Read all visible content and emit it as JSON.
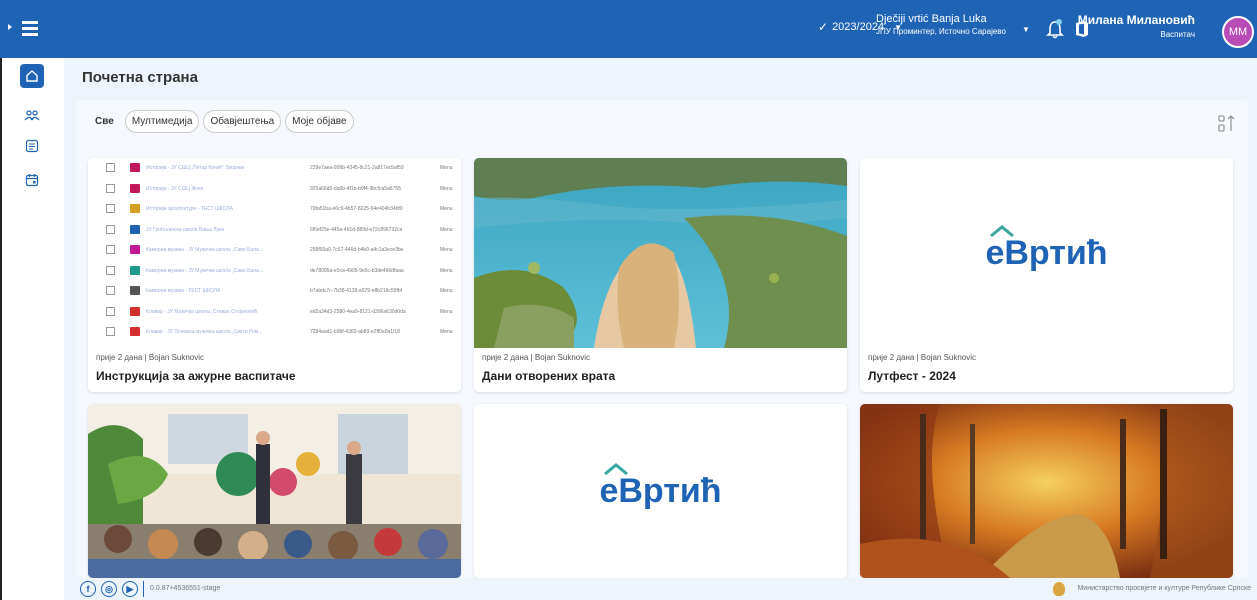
{
  "header": {
    "school_year": "2023/2024",
    "kindergarten_name": "Dječiji vrtić Banja Luka",
    "kindergarten_sub": "ЈПУ Проминтер, Источно Сарајево",
    "user_name": "Милана Милановић",
    "user_role": "Васпитач",
    "avatar_initials": "ММ"
  },
  "sidebar": {
    "items": [
      {
        "icon": "home-icon"
      },
      {
        "icon": "children-icon"
      },
      {
        "icon": "board-icon"
      },
      {
        "icon": "calendar-icon"
      }
    ]
  },
  "page": {
    "title": "Почетна страна"
  },
  "filters": [
    "Све",
    "Мултимедија",
    "Обавјештења",
    "Моје објаве"
  ],
  "posts": [
    {
      "meta": "прије 2 дана | Bojan Suknovic",
      "title": "Инструкција за ажурне васпитаче",
      "media": "spreadsheet"
    },
    {
      "meta": "прије 2 дана | Bojan Suknovic",
      "title": "Дани отворених врата",
      "media": "lake-photo"
    },
    {
      "meta": "прије 2 дана | Bojan Suknovic",
      "title": "Лутфест - 2024",
      "media": "logo"
    },
    {
      "media": "kids-photo"
    },
    {
      "media": "logo"
    },
    {
      "media": "autumn-photo"
    }
  ],
  "logo_text": "еВртић",
  "sheet_rows": [
    {
      "name": "Историја - JУ СШЦ „Петар Кочић\" Зворник",
      "id": "229e7aea-999b-4345-8c21-2a817ec5af59",
      "col": "Menu",
      "color": "#c2185b"
    },
    {
      "name": "Историја - JУ СШЦ Фоча",
      "id": "925a66d5-da6b-4f1b-b9f4-9bcfca5a6755",
      "col": "Menu",
      "color": "#c2185b"
    },
    {
      "name": "Историја архитектуре - ТЕСТ ШКОЛА",
      "id": "79fa51ba-e6c9-4b57-8225-54e404b34bf0",
      "col": "Menu",
      "color": "#d4a020"
    },
    {
      "name": "JУ Гробљанска школа Бања Лука",
      "id": "6f6ef25e-445a-4b1d-889d-e72c896732ca",
      "col": "Menu",
      "color": "#1f64b4"
    },
    {
      "name": "Камерна музика - JУ Музичка школа „Саво Бала...",
      "id": "258f93a0-7c67-446d-b4b9-a4c1a3ece3be",
      "col": "Menu",
      "color": "#c21893"
    },
    {
      "name": "Камерна музика - JУ Музичка школа „Саво Бала...",
      "id": "de78095a-e5ca-4905-9e5c-b3de466dfaaa",
      "col": "Menu",
      "color": "#1b9a8a"
    },
    {
      "name": "Камерна музика - ТЕСТ ШКОЛА",
      "id": "b7abdc7c-7b38-4139-a079-e8b216c59fbf",
      "col": "Menu",
      "color": "#555555"
    },
    {
      "name": "Клавир - JУ Музичка школа „Стеван Стојановић",
      "id": "ed2a34d3-2580-4ea9-8121-d396a630d0da",
      "col": "Menu",
      "color": "#d32f2f"
    },
    {
      "name": "Клавир - JУ Основна музичка школа „Свети Ром...",
      "id": "7284aad1-b9bf-4363-ab89-e2ff0a0a1f18",
      "col": "Menu",
      "color": "#d32f2f"
    }
  ],
  "footer": {
    "version": "0.0.87+4536551-stage",
    "ministry": "Министарство просвјете и културе Републике Српске"
  },
  "colors": {
    "primary": "#1f64b4",
    "avatar": "#b84bb5",
    "background": "#eef4fb"
  }
}
